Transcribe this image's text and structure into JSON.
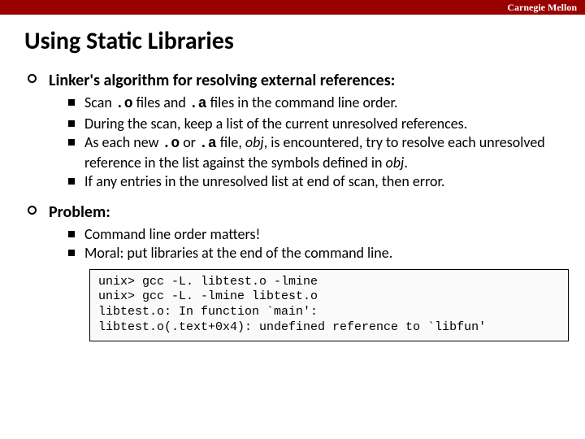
{
  "header": {
    "institution": "Carnegie Mellon"
  },
  "title": "Using Static Libraries",
  "sections": [
    {
      "heading": "Linker's algorithm for resolving external references:",
      "items": [
        {
          "pre1": "Scan ",
          "code1": ".o",
          "mid1": " files and ",
          "code2": ".a",
          "post1": " files in the command line order."
        },
        {
          "text": "During the scan, keep a list of the current unresolved references."
        },
        {
          "pre1": "As each new ",
          "code1": ".o",
          "mid1": " or ",
          "code2": ".a",
          "post1": " file, ",
          "objword1": "obj",
          "post2": ", is encountered, try to resolve each unresolved reference in the list against the symbols defined in ",
          "objword2": "obj",
          "post3": "."
        },
        {
          "text": "If any entries in the unresolved list at end of scan, then error."
        }
      ]
    },
    {
      "heading": "Problem:",
      "items": [
        {
          "text": "Command line order matters!"
        },
        {
          "text": "Moral: put libraries at the end of the command line."
        }
      ]
    }
  ],
  "codebox": "unix> gcc -L. libtest.o -lmine\nunix> gcc -L. -lmine libtest.o\nlibtest.o: In function `main':\nlibtest.o(.text+0x4): undefined reference to `libfun'"
}
